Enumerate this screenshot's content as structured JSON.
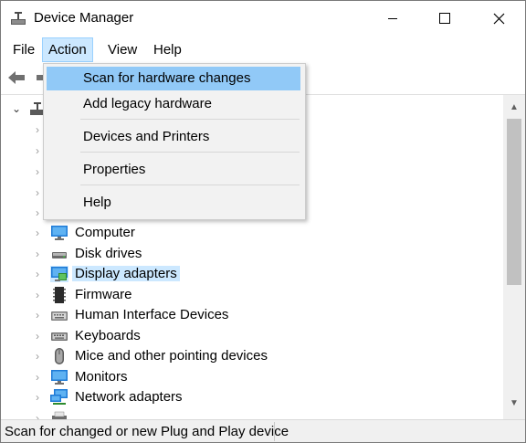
{
  "window": {
    "title": "Device Manager",
    "app_icon": "device-manager-icon"
  },
  "menubar": {
    "items": [
      "File",
      "Action",
      "View",
      "Help"
    ],
    "active": "Action"
  },
  "toolbar": {
    "icons": [
      "back-arrow-icon",
      "forward-arrow-icon"
    ]
  },
  "action_menu": {
    "items": [
      "Scan for hardware changes",
      "Add legacy hardware",
      "Devices and Printers",
      "Properties",
      "Help"
    ],
    "highlighted": "Scan for hardware changes"
  },
  "tree": {
    "visible_items": [
      {
        "label": "Computer",
        "icon": "computer-icon"
      },
      {
        "label": "Disk drives",
        "icon": "disk-drive-icon"
      },
      {
        "label": "Display adapters",
        "icon": "display-adapter-icon",
        "selected": true
      },
      {
        "label": "Firmware",
        "icon": "firmware-icon"
      },
      {
        "label": "Human Interface Devices",
        "icon": "hid-icon"
      },
      {
        "label": "Keyboards",
        "icon": "keyboard-icon"
      },
      {
        "label": "Mice and other pointing devices",
        "icon": "mouse-icon"
      },
      {
        "label": "Monitors",
        "icon": "monitor-icon"
      },
      {
        "label": "Network adapters",
        "icon": "network-adapter-icon"
      }
    ]
  },
  "statusbar": {
    "text": "Scan for changed or new Plug and Play device"
  },
  "colors": {
    "selection": "#cce8ff",
    "menu_highlight": "#91c9f7",
    "menu_background": "#f2f2f2"
  }
}
